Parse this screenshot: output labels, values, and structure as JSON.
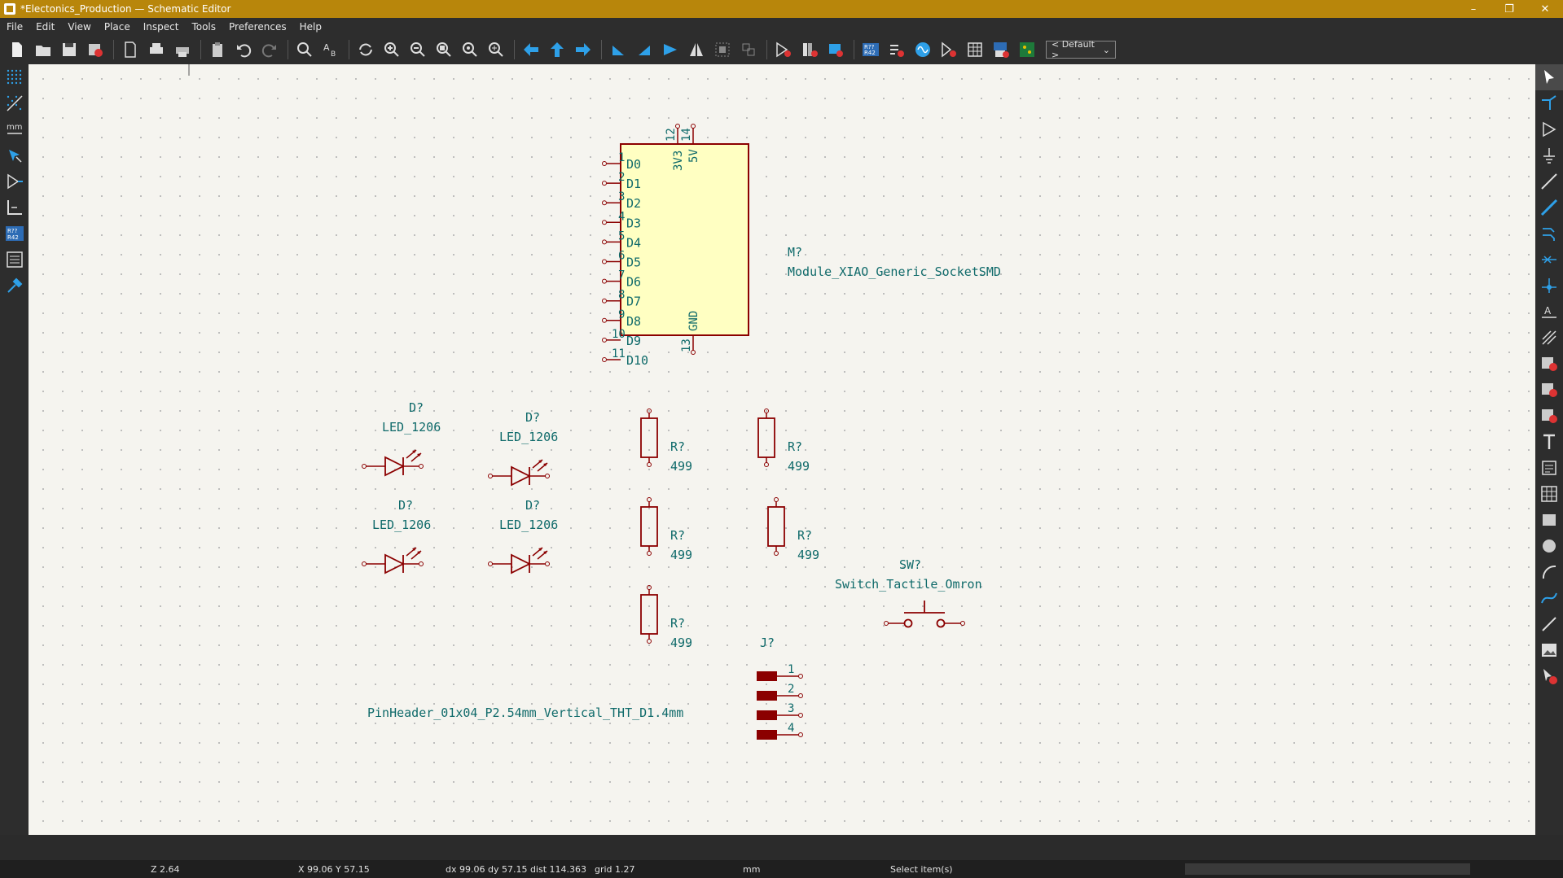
{
  "window": {
    "title": "*Electonics_Production — Schematic Editor",
    "controls": {
      "minimize": "–",
      "maximize": "❐",
      "close": "✕"
    }
  },
  "menu": [
    "File",
    "Edit",
    "View",
    "Place",
    "Inspect",
    "Tools",
    "Preferences",
    "Help"
  ],
  "toolbar": {
    "layer_select": "< Default >"
  },
  "schematic": {
    "module": {
      "ref": "M?",
      "value": "Module_XIAO_Generic_SocketSMD",
      "left_pins": [
        {
          "num": "1",
          "name": "D0"
        },
        {
          "num": "2",
          "name": "D1"
        },
        {
          "num": "3",
          "name": "D2"
        },
        {
          "num": "4",
          "name": "D3"
        },
        {
          "num": "5",
          "name": "D4"
        },
        {
          "num": "6",
          "name": "D5"
        },
        {
          "num": "7",
          "name": "D6"
        },
        {
          "num": "8",
          "name": "D7"
        },
        {
          "num": "9",
          "name": "D8"
        },
        {
          "num": "10",
          "name": "D9"
        },
        {
          "num": "11",
          "name": "D10"
        }
      ],
      "top_pins": [
        {
          "num": "12",
          "name": "3V3"
        },
        {
          "num": "14",
          "name": "5V"
        }
      ],
      "bottom_pins": [
        {
          "num": "13",
          "name": "GND"
        }
      ]
    },
    "leds": [
      {
        "ref": "D?",
        "value": "LED_1206"
      },
      {
        "ref": "D?",
        "value": "LED_1206"
      },
      {
        "ref": "D?",
        "value": "LED_1206"
      },
      {
        "ref": "D?",
        "value": "LED_1206"
      }
    ],
    "resistors": [
      {
        "ref": "R?",
        "value": "499"
      },
      {
        "ref": "R?",
        "value": "499"
      },
      {
        "ref": "R?",
        "value": "499"
      },
      {
        "ref": "R?",
        "value": "499"
      },
      {
        "ref": "R?",
        "value": "499"
      }
    ],
    "switch": {
      "ref": "SW?",
      "value": "Switch_Tactile_Omron"
    },
    "header": {
      "ref": "J?",
      "value": "PinHeader_01x04_P2.54mm_Vertical_THT_D1.4mm",
      "pins": [
        "1",
        "2",
        "3",
        "4"
      ]
    }
  },
  "status": {
    "zoom": "Z 2.64",
    "xy": "X 99.06  Y 57.15",
    "delta": "dx 99.06  dy 57.15  dist 114.363",
    "grid": "grid 1.27",
    "units": "mm",
    "message": "Select item(s)"
  },
  "colors": {
    "title_bar": "#b8860b",
    "symbol_body": "#ffffc2",
    "symbol_outline": "#8b0000",
    "text": "#0f6a6a",
    "canvas": "#f5f4ef",
    "accent_blue": "#2ea0e8"
  }
}
